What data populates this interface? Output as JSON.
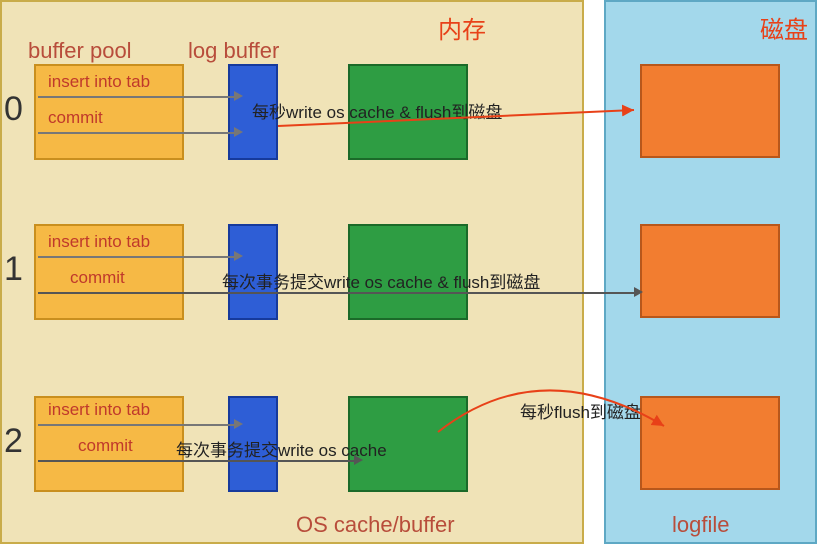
{
  "areas": {
    "memory": "内存",
    "disk": "磁盘"
  },
  "headers": {
    "buffer_pool": "buffer pool",
    "log_buffer": "log buffer",
    "os_cache": "OS cache/buffer",
    "logfile": "logfile"
  },
  "rows": [
    {
      "index": "0",
      "op1": "insert into tab",
      "op2": "commit",
      "flow1": "每秒write os cache & flush到磁盘",
      "flow2": ""
    },
    {
      "index": "1",
      "op1": "insert into tab",
      "op2": "commit",
      "flow1": "每次事务提交write os cache & flush到磁盘",
      "flow2": ""
    },
    {
      "index": "2",
      "op1": "insert into tab",
      "op2": "commit",
      "flow1": "每次事务提交write os cache",
      "flow2": "每秒flush到磁盘"
    }
  ],
  "colors": {
    "memory_bg": "#f0e3b7",
    "disk_bg": "#a3d8eb",
    "buffer": "#f6b945",
    "log": "#2e5ed6",
    "os": "#2e9d43",
    "file": "#f27d30",
    "red": "#e84118"
  }
}
